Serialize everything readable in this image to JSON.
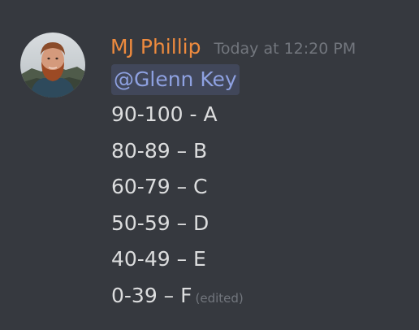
{
  "message": {
    "author": "MJ Phillip",
    "timestamp": "Today at 12:20 PM",
    "author_color": "#ed8a3e",
    "mention": "@Glenn Key",
    "lines": [
      "90-100 - A",
      "80-89 – B",
      "60-79 – C",
      "50-59 – D",
      "40-49 – E",
      "0-39 – F"
    ],
    "edited_label": "(edited)"
  },
  "colors": {
    "background": "#36393f",
    "text": "#dcddde",
    "muted": "#72767d",
    "mention_text": "#8ea1e1"
  }
}
